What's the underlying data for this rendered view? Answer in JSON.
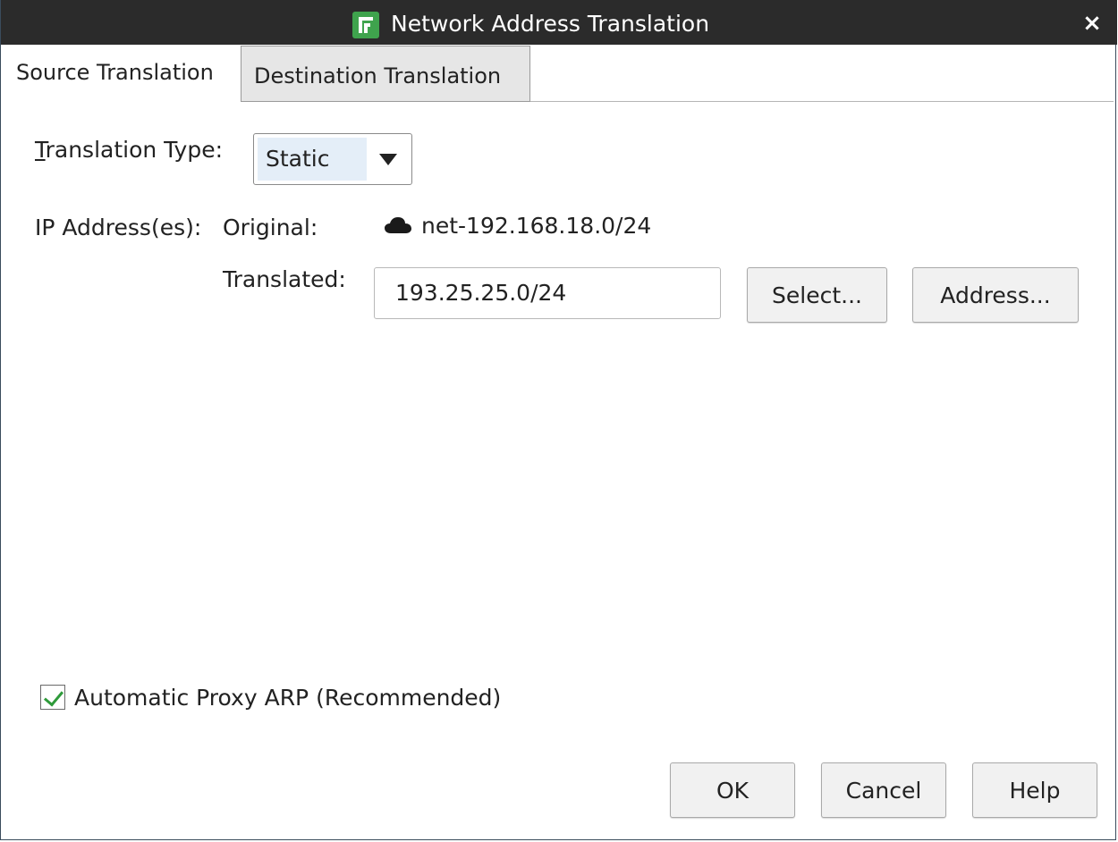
{
  "window": {
    "title": "Network Address Translation",
    "close_symbol": "×"
  },
  "tabs": [
    {
      "label": "Source Translation",
      "active": true
    },
    {
      "label": "Destination Translation",
      "active": false
    }
  ],
  "form": {
    "translation_type_label": "Translation Type:",
    "translation_type_value": "Static",
    "ip_addresses_label": "IP Address(es):",
    "original_label": "Original:",
    "original_value": "net-192.168.18.0/24",
    "original_icon": "cloud-network-icon",
    "translated_label": "Translated:",
    "translated_value": "193.25.25.0/24",
    "select_button": "Select...",
    "address_button": "Address..."
  },
  "options": {
    "proxy_arp_label": "Automatic Proxy ARP (Recommended)",
    "proxy_arp_checked": true
  },
  "buttons": {
    "ok": "OK",
    "cancel": "Cancel",
    "help": "Help"
  },
  "colors": {
    "titlebar": "#2b2b2b",
    "app_icon": "#3fa34d",
    "check": "#2e9a3a",
    "combo_highlight": "#e4eef8"
  }
}
